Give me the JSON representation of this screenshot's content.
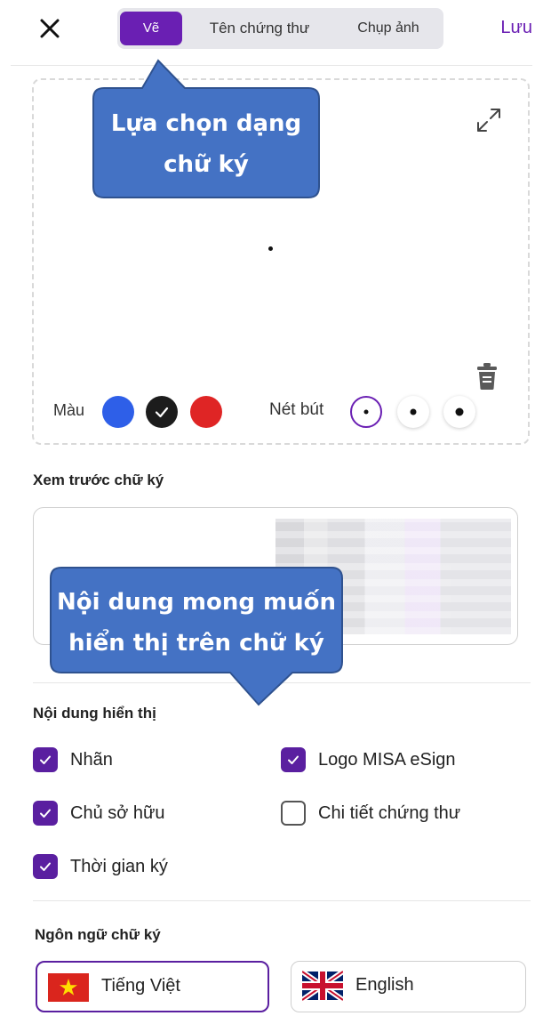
{
  "header": {
    "close_icon": "close-icon",
    "tabs": [
      {
        "label": "Vẽ",
        "active": true
      },
      {
        "label": "Tên chứng thư",
        "active": false
      },
      {
        "label": "Chụp ảnh",
        "active": false
      }
    ],
    "save_label": "Lưu"
  },
  "draw": {
    "color_label": "Màu",
    "colors": [
      "#2e5fe8",
      "#1c1c1c",
      "#df2525"
    ],
    "selected_color": "#1c1c1c",
    "pen_label": "Nét bút",
    "pen_sizes": [
      "thin",
      "medium",
      "thick"
    ],
    "selected_pen": "thin"
  },
  "preview": {
    "title": "Xem trước chữ ký"
  },
  "content": {
    "title": "Nội dung hiển thị",
    "options": [
      {
        "label": "Nhãn",
        "checked": true
      },
      {
        "label": "Logo MISA eSign",
        "checked": true
      },
      {
        "label": "Chủ sở hữu",
        "checked": true
      },
      {
        "label": "Chi tiết chứng thư",
        "checked": false
      },
      {
        "label": "Thời gian ký",
        "checked": true
      }
    ]
  },
  "language": {
    "title": "Ngôn ngữ chữ ký",
    "options": [
      {
        "label": "Tiếng Việt",
        "flag": "vietnam-flag",
        "selected": true
      },
      {
        "label": "English",
        "flag": "uk-flag",
        "selected": false
      }
    ]
  },
  "callouts": {
    "signature_type": "Lựa chọn dạng chữ ký",
    "signature_content": "Nội dung mong muốn hiển thị trên chữ ký"
  },
  "colors": {
    "accent": "#6a1fb3",
    "callout": "#4472c4"
  }
}
